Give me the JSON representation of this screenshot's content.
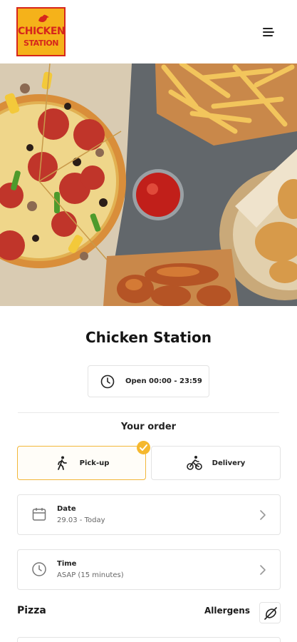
{
  "header": {
    "logo_line1": "CHICKEN",
    "logo_line2": "STATION"
  },
  "restaurant": {
    "name": "Chicken Station",
    "hours": "Open 00:00 - 23:59"
  },
  "order": {
    "heading": "Your order",
    "options": [
      {
        "label": "Pick-up",
        "selected": true
      },
      {
        "label": "Delivery",
        "selected": false
      }
    ],
    "date": {
      "label": "Date",
      "value": "29.03 - Today"
    },
    "time": {
      "label": "Time",
      "value": "ASAP (15 minutes)"
    }
  },
  "menu": {
    "category": "Pizza",
    "allergens_label": "Allergens"
  },
  "colors": {
    "accent": "#f5b82e",
    "logo_red": "#d6261c",
    "logo_yellow": "#f5b21a"
  }
}
